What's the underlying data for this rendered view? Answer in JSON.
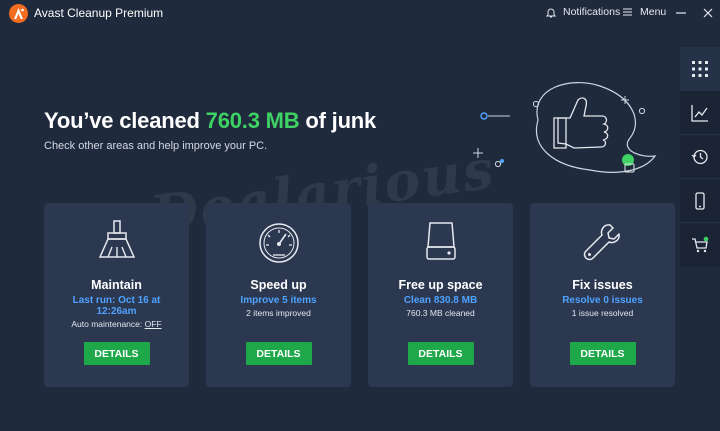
{
  "app": {
    "title": "Avast Cleanup Premium"
  },
  "header": {
    "notifications_label": "Notifications",
    "menu_label": "Menu"
  },
  "hero": {
    "title_prefix": "You’ve cleaned",
    "title_amount": "760.3 MB",
    "title_suffix": "of junk",
    "subtitle": "Check other areas and help improve your PC."
  },
  "watermark": "Dealarious",
  "rail": {
    "items": [
      "apps-grid-icon",
      "chart-icon",
      "history-icon",
      "phone-icon",
      "cart-icon"
    ]
  },
  "cards": [
    {
      "title": "Maintain",
      "link": "Last run: Oct 16 at 12:26am",
      "note_prefix": "Auto maintenance:",
      "note_value": "OFF",
      "button": "DETAILS"
    },
    {
      "title": "Speed up",
      "link": "Improve 5 items",
      "note": "2 items improved",
      "button": "DETAILS"
    },
    {
      "title": "Free up space",
      "link": "Clean 830.8 MB",
      "note": "760.3 MB cleaned",
      "button": "DETAILS"
    },
    {
      "title": "Fix issues",
      "link": "Resolve 0 issues",
      "note": "1 issue resolved",
      "button": "DETAILS"
    }
  ],
  "colors": {
    "background": "#1f2a3d",
    "card": "#2c3750",
    "accent_green": "#3ed163",
    "link_blue": "#4ea3ff",
    "button_green": "#1ea84a",
    "logo_orange": "#f26c21"
  }
}
